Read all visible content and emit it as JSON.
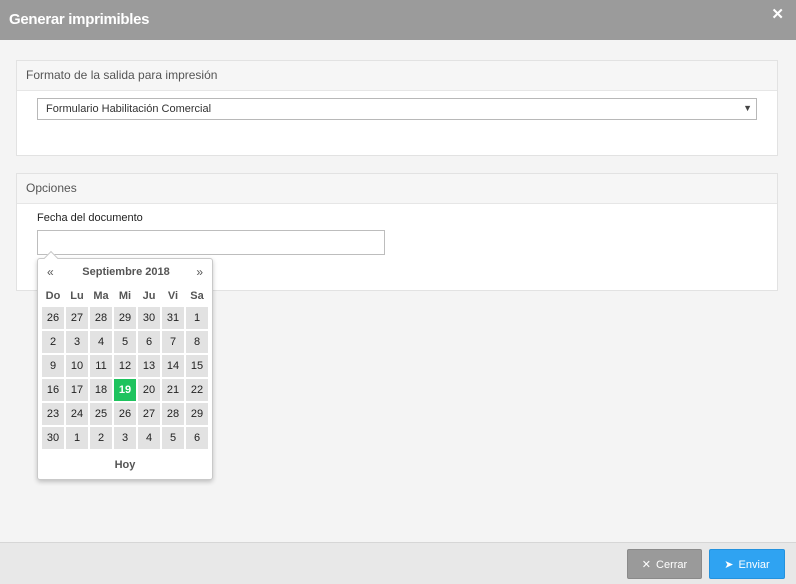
{
  "dialog": {
    "title": "Generar imprimibles",
    "close_glyph": "✕"
  },
  "format_panel": {
    "heading": "Formato de la salida para impresión",
    "selected_value": "Formulario Habilitación Comercial",
    "caret": "▼"
  },
  "options_panel": {
    "heading": "Opciones",
    "date_label": "Fecha del documento",
    "date_value": ""
  },
  "datepicker": {
    "prev": "«",
    "next": "»",
    "month_label": "Septiembre 2018",
    "weekdays": [
      "Do",
      "Lu",
      "Ma",
      "Mi",
      "Ju",
      "Vi",
      "Sa"
    ],
    "weeks": [
      [
        "26",
        "27",
        "28",
        "29",
        "30",
        "31",
        "1"
      ],
      [
        "2",
        "3",
        "4",
        "5",
        "6",
        "7",
        "8"
      ],
      [
        "9",
        "10",
        "11",
        "12",
        "13",
        "14",
        "15"
      ],
      [
        "16",
        "17",
        "18",
        "19",
        "20",
        "21",
        "22"
      ],
      [
        "23",
        "24",
        "25",
        "26",
        "27",
        "28",
        "29"
      ],
      [
        "30",
        "1",
        "2",
        "3",
        "4",
        "5",
        "6"
      ]
    ],
    "selected_day": "19",
    "today_label": "Hoy",
    "selected_color": "#1ec35e"
  },
  "footer": {
    "close_label": "Cerrar",
    "close_icon": "close-icon",
    "send_label": "Enviar",
    "send_icon": "send-icon",
    "send_color": "#2fa3f2"
  }
}
